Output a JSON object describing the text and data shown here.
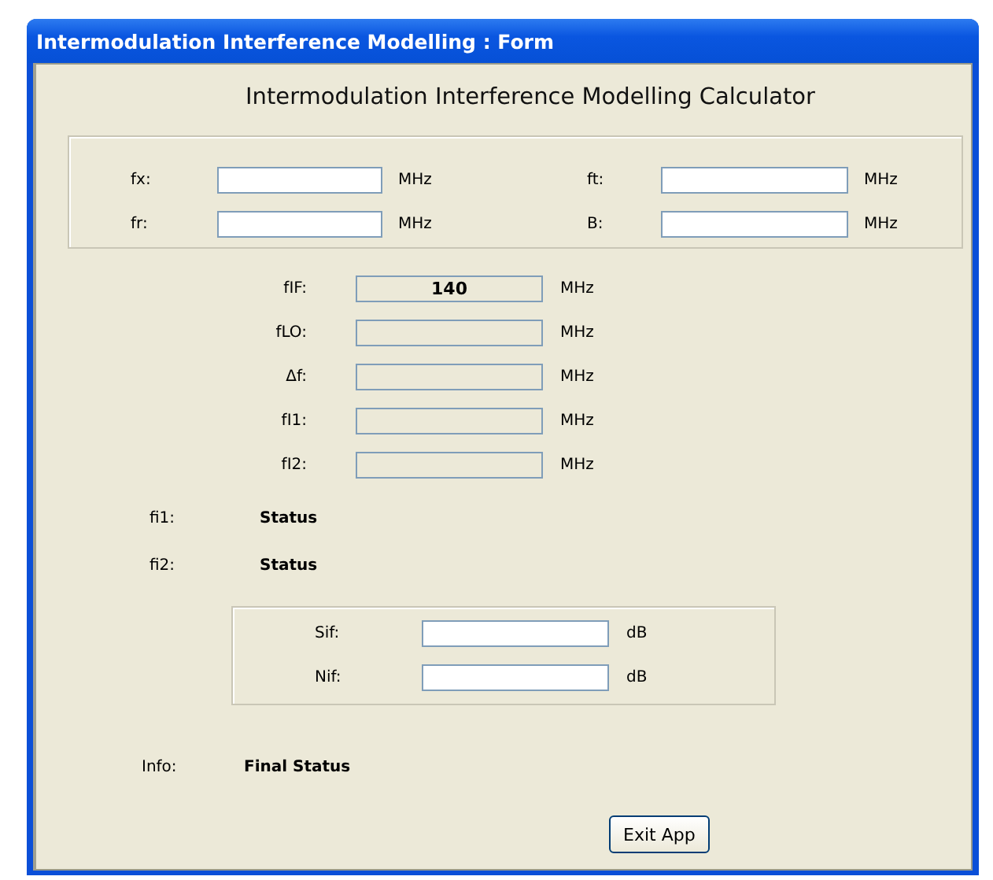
{
  "window": {
    "title": "Intermodulation Interference Modelling : Form"
  },
  "heading": "Intermodulation Interference Modelling Calculator",
  "input_group": {
    "fields": [
      {
        "label": "fx:",
        "unit": "MHz"
      },
      {
        "label": "ft:",
        "unit": "MHz"
      },
      {
        "label": "fr:",
        "unit": "MHz"
      },
      {
        "label": "B:",
        "unit": "MHz"
      }
    ]
  },
  "outputs": [
    {
      "label": "fIF:",
      "value": "140",
      "unit": "MHz"
    },
    {
      "label": "fLO:",
      "unit": "MHz"
    },
    {
      "label": "Δf:",
      "unit": "MHz"
    },
    {
      "label": "fI1:",
      "unit": "MHz"
    },
    {
      "label": "fI2:",
      "unit": "MHz"
    }
  ],
  "status_rows": [
    {
      "label": "fi1:",
      "value": "Status"
    },
    {
      "label": "fi2:",
      "value": "Status"
    }
  ],
  "signal_group": {
    "fields": [
      {
        "label": "Sif:",
        "unit": "dB"
      },
      {
        "label": "Nif:",
        "unit": "dB"
      }
    ]
  },
  "info": {
    "label": "Info:",
    "value": "Final Status"
  },
  "buttons": [
    "Exit App"
  ]
}
